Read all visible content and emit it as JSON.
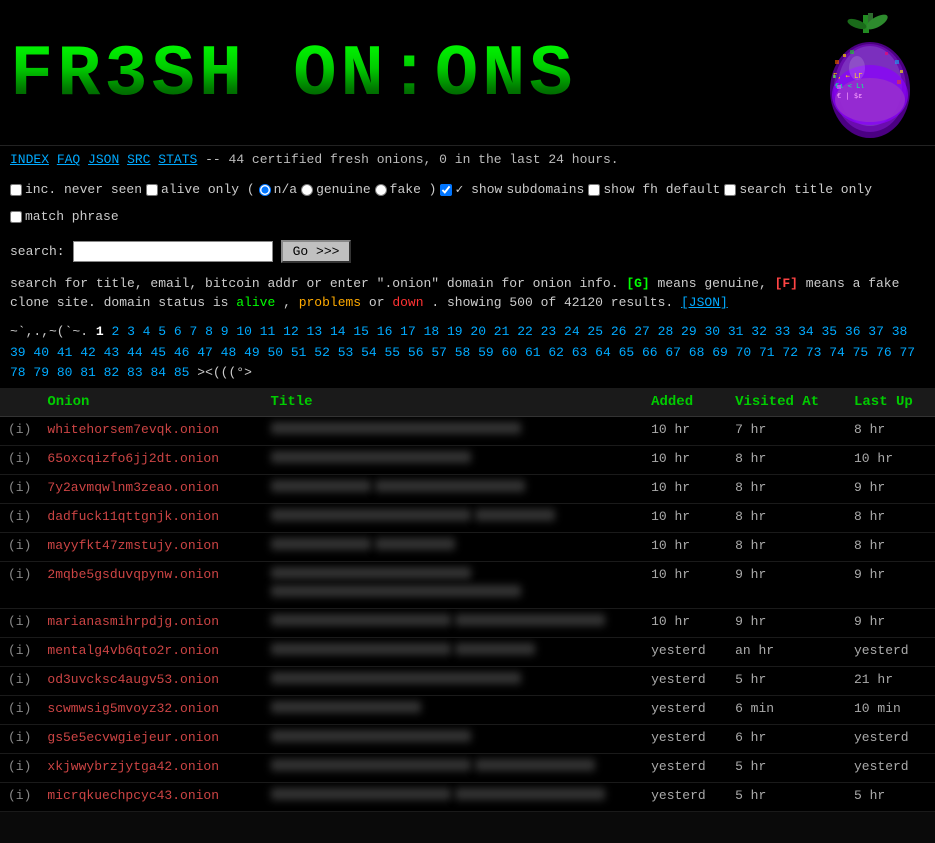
{
  "header": {
    "logo_text": "FR3SH ON:ONS",
    "tagline": "-- 44 certified fresh onions, 0 in the last 24 hours."
  },
  "navbar": {
    "links": [
      "INDEX",
      "FAQ",
      "JSON",
      "SRC",
      "STATS"
    ]
  },
  "options": {
    "checkboxes": [
      {
        "id": "inc_never",
        "label": "inc. never seen",
        "checked": false
      },
      {
        "id": "alive_only",
        "label": "alive only (",
        "checked": false
      },
      {
        "id": "show_subs",
        "label": "show subdomains",
        "checked": false
      },
      {
        "id": "show_fh",
        "label": "show fh default",
        "checked": false
      },
      {
        "id": "search_title",
        "label": "search title only",
        "checked": false
      },
      {
        "id": "match_phrase",
        "label": "match phrase",
        "checked": false
      },
      {
        "id": "show_chk",
        "label": "show",
        "checked": true
      }
    ],
    "radio_options": [
      {
        "id": "r_na",
        "label": "n/a",
        "checked": true
      },
      {
        "id": "r_genuine",
        "label": "genuine",
        "checked": false
      },
      {
        "id": "r_fake",
        "label": "fake )",
        "checked": false
      }
    ]
  },
  "search": {
    "label": "search:",
    "placeholder": "",
    "button_label": "Go >>>"
  },
  "info": {
    "line1": "search for title, email, bitcoin addr or enter \".onion\" domain for onion info.",
    "genuine_badge": "[G]",
    "genuine_desc": "means genuine,",
    "fake_badge": "[F]",
    "fake_desc": "means a fake clone site. domain status is",
    "alive": "alive",
    "problems": "problems",
    "or": "or",
    "down": "down",
    "showing": ". showing 500 of 42120 results.",
    "json_link": "[JSON]"
  },
  "pagination": {
    "prefix": "~`,.,~(`~. ",
    "current": "1",
    "pages": [
      "2",
      "3",
      "4",
      "5",
      "6",
      "7",
      "8",
      "9",
      "10",
      "11",
      "12",
      "13",
      "14",
      "15",
      "16",
      "17",
      "18",
      "19",
      "20",
      "21",
      "22",
      "23",
      "24",
      "25",
      "26",
      "27",
      "28",
      "29",
      "30",
      "31",
      "32",
      "33",
      "34",
      "35",
      "36",
      "37",
      "38",
      "39",
      "40",
      "41",
      "42",
      "43",
      "44",
      "45",
      "46",
      "47",
      "48",
      "49",
      "50",
      "51",
      "52",
      "53",
      "54",
      "55",
      "56",
      "57",
      "58",
      "59",
      "60",
      "61",
      "62",
      "63",
      "64",
      "65",
      "66",
      "67",
      "68",
      "69",
      "70",
      "71",
      "72",
      "73",
      "74",
      "75",
      "76",
      "77",
      "78",
      "79",
      "80",
      "81",
      "82",
      "83",
      "84",
      "85"
    ],
    "suffix": "><(((°>"
  },
  "table": {
    "headers": [
      "",
      "Onion",
      "Title",
      "Added",
      "Visited At",
      "Last Up"
    ],
    "rows": [
      {
        "i": "(i)",
        "onion": "whitehorsem7evqk.onion",
        "title": "",
        "added": "10 hr",
        "visited": "7 hr",
        "last_up": "8 hr"
      },
      {
        "i": "(i)",
        "onion": "65oxcqizfo6jj2dt.onion",
        "title": "",
        "added": "10 hr",
        "visited": "8 hr",
        "last_up": "10 hr"
      },
      {
        "i": "(i)",
        "onion": "7y2avmqwlnm3zeao.onion",
        "title": "",
        "added": "10 hr",
        "visited": "8 hr",
        "last_up": "9 hr"
      },
      {
        "i": "(i)",
        "onion": "dadfuck11qttgnjk.onion",
        "title": "",
        "added": "10 hr",
        "visited": "8 hr",
        "last_up": "8 hr"
      },
      {
        "i": "(i)",
        "onion": "mayyfkt47zmstujy.onion",
        "title": "",
        "added": "10 hr",
        "visited": "8 hr",
        "last_up": "8 hr"
      },
      {
        "i": "(i)",
        "onion": "2mqbe5gsduvqpynw.onion",
        "title": "",
        "added": "10 hr",
        "visited": "9 hr",
        "last_up": "9 hr"
      },
      {
        "i": "(i)",
        "onion": "marianasmihrpdjg.onion",
        "title": "",
        "added": "10 hr",
        "visited": "9 hr",
        "last_up": "9 hr"
      },
      {
        "i": "(i)",
        "onion": "mentalg4vb6qto2r.onion",
        "title": "",
        "added": "yesterd",
        "visited": "an hr",
        "last_up": "yesterd"
      },
      {
        "i": "(i)",
        "onion": "od3uvcksc4augv53.onion",
        "title": "",
        "added": "yesterd",
        "visited": "5 hr",
        "last_up": "21 hr"
      },
      {
        "i": "(i)",
        "onion": "scwmwsig5mvoyz32.onion",
        "title": "",
        "added": "yesterd",
        "visited": "6 min",
        "last_up": "10 min"
      },
      {
        "i": "(i)",
        "onion": "gs5e5ecvwgiejeur.onion",
        "title": "",
        "added": "yesterd",
        "visited": "6 hr",
        "last_up": "yesterd"
      },
      {
        "i": "(i)",
        "onion": "xkjwwybrzjytga42.onion",
        "title": "",
        "added": "yesterd",
        "visited": "5 hr",
        "last_up": "yesterd"
      },
      {
        "i": "(i)",
        "onion": "micrqkuechpcyc43.onion",
        "title": "",
        "added": "yesterd",
        "visited": "5 hr",
        "last_up": "5 hr"
      }
    ]
  },
  "colors": {
    "accent_green": "#00cc00",
    "link_blue": "#00aaff",
    "onion_red": "#cc4444",
    "alive": "#00ff00",
    "problems": "#ffaa00",
    "down": "#ff3333"
  }
}
